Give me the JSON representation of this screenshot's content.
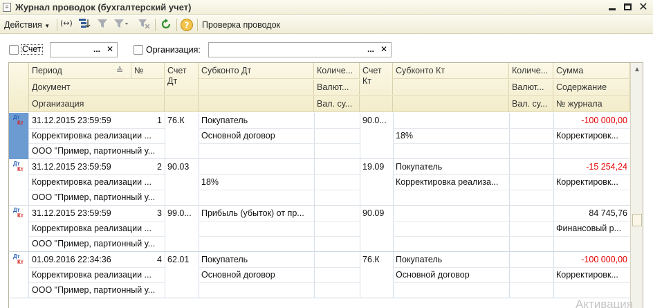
{
  "window": {
    "title": "Журнал проводок (бухгалтерский учет)",
    "icon_glyph": "≡"
  },
  "toolbar": {
    "actions_label": "Действия",
    "check_label": "Проверка проводок"
  },
  "filters": {
    "account_label": "Счет",
    "account_value": "",
    "organization_label": "Организация:",
    "organization_value": "",
    "select_glyph": "...",
    "clear_glyph": "✕"
  },
  "columns": {
    "period": "Период",
    "number": "№",
    "account_dt": "Счет Дт",
    "subconto_dt": "Субконто Дт",
    "quantity_dt": "Количе...",
    "account_kt": "Счет Кт",
    "subconto_kt": "Субконто Кт",
    "quantity_kt": "Количе...",
    "amount": "Сумма",
    "document": "Документ",
    "currency_dt": "Валют...",
    "currency_kt": "Валют...",
    "content": "Содержание",
    "organization": "Организация",
    "currency_amount_dt": "Вал. су...",
    "currency_amount_kt": "Вал. су...",
    "journal_number": "№ журнала"
  },
  "rows": [
    {
      "period": "31.12.2015 23:59:59",
      "number": "1",
      "account_dt": "76.К",
      "subconto_dt_1": "Покупатель",
      "subconto_dt_2": "Основной договор",
      "account_kt": "90.0...",
      "subconto_kt_1": "",
      "subconto_kt_2": "18%",
      "amount": "-100 000,00",
      "document": "Корректировка реализации ...",
      "content": "Корректировк...",
      "organization": "ООО \"Пример, партионный у...",
      "selected": true
    },
    {
      "period": "31.12.2015 23:59:59",
      "number": "2",
      "account_dt": "90.03",
      "subconto_dt_1": "",
      "subconto_dt_2": "18%",
      "account_kt": "19.09",
      "subconto_kt_1": "Покупатель",
      "subconto_kt_2": "Корректировка реализа...",
      "amount": "-15 254,24",
      "document": "Корректировка реализации ...",
      "content": "Корректировк...",
      "organization": "ООО \"Пример, партионный у...",
      "selected": false
    },
    {
      "period": "31.12.2015 23:59:59",
      "number": "3",
      "account_dt": "99.0...",
      "subconto_dt_1": "Прибыль (убыток) от пр...",
      "subconto_dt_2": "",
      "account_kt": "90.09",
      "subconto_kt_1": "",
      "subconto_kt_2": "",
      "amount": "84 745,76",
      "document": "Корректировка реализации ...",
      "content": "Финансовый р...",
      "organization": "ООО \"Пример, партионный у...",
      "selected": false
    },
    {
      "period": "01.09.2016 22:34:36",
      "number": "4",
      "account_dt": "62.01",
      "subconto_dt_1": "Покупатель",
      "subconto_dt_2": "Основной договор",
      "account_kt": "76.К",
      "subconto_kt_1": "Покупатель",
      "subconto_kt_2": "Основной договор",
      "amount": "-100 000,00",
      "document": "Корректировка реализации ...",
      "content": "Корректировк...",
      "organization": "ООО \"Пример, партионный у...",
      "selected": false
    }
  ],
  "row_marker": {
    "dt": "Дт",
    "kt": "Кт"
  },
  "watermark": "Активация",
  "colors": {
    "negative": "#e60000",
    "selection": "#6c9bd2",
    "header_bg": "#f3ecca"
  }
}
